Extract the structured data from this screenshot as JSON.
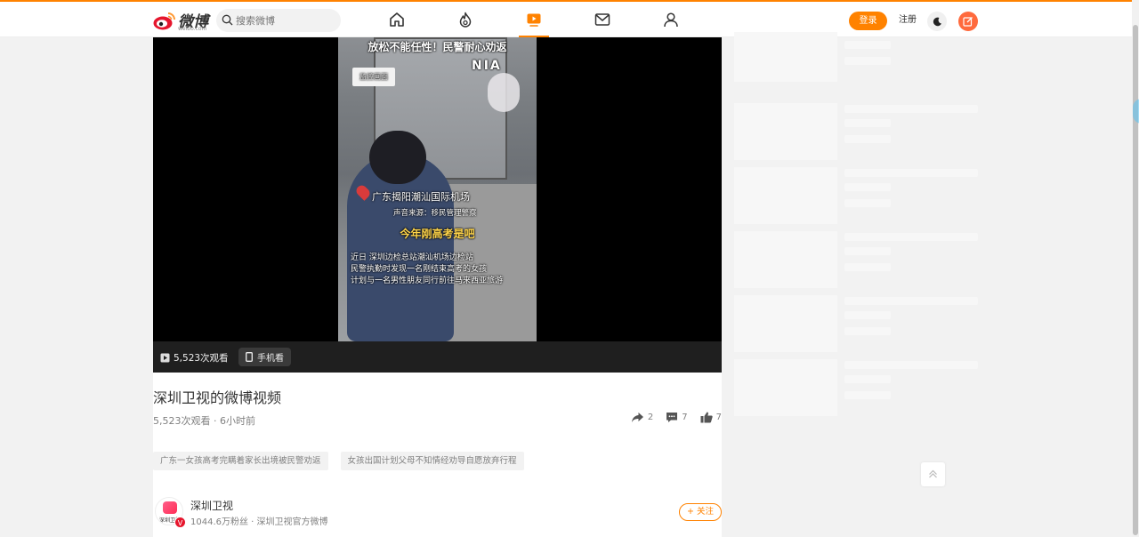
{
  "header": {
    "logo_text": "微博",
    "logo_sub": "weibo.com",
    "search_placeholder": "搜索微博",
    "login_label": "登录",
    "register_label": "注册",
    "nav": [
      "home-icon",
      "hot-icon",
      "video-icon",
      "message-icon",
      "profile-icon"
    ],
    "active_nav": "video-icon",
    "accent_color": "#ff8200"
  },
  "video": {
    "overlay_title": "放松不能任性！民警耐心劝返",
    "overlay_tag": "监控画面",
    "overlay_logo": "NIA",
    "location": "广东揭阳潮汕国际机场",
    "source": "声音来源：移民管理警察",
    "highlight": "今年刚高考是吧",
    "body_lines": [
      "近日 深圳边检总站潮汕机场边检站",
      "民警执勤时发现一名刚结束高考的女孩",
      "计划与一名男性朋友同行前往马来西亚旅游"
    ],
    "view_count": "5,523次观看",
    "phone_label": "手机看"
  },
  "post": {
    "title": "深圳卫视的微博视频",
    "meta": "5,523次观看 · 6小时前",
    "shares": "2",
    "comments": "7",
    "likes": "7",
    "tags": [
      "广东一女孩高考完瞒着家长出境被民警劝返",
      "女孩出国计划父母不知情经劝导自愿放弃行程"
    ]
  },
  "author": {
    "name": "深圳卫视",
    "avatar_text": "深圳卫视",
    "verified_badge": "V",
    "sub": "1044.6万粉丝 · 深圳卫视官方微博",
    "follow_label": "+ 关注"
  }
}
